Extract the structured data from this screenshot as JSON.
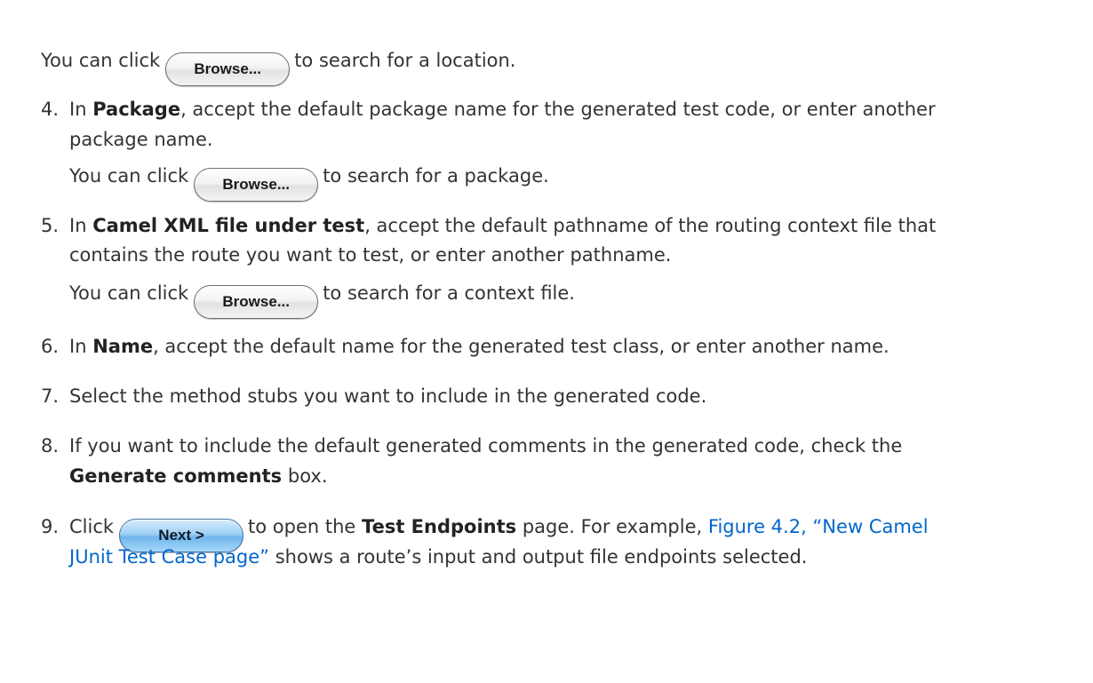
{
  "browse_label": "Browse...",
  "next_label": "Next >",
  "intro": {
    "before": "You can click",
    "after": "to search for a location."
  },
  "steps": [
    {
      "number": "4.",
      "pre": "In",
      "bold": "Package",
      "text": ", accept the default package name for the generated test code, or enter another",
      "text2": "package name.",
      "click_before": "You can click",
      "click_after": "to search for a package."
    },
    {
      "number": "5.",
      "pre": "In",
      "bold": "Camel XML file under test",
      "text": ", accept the default pathname of the routing context file that",
      "text2": "contains the route you want to test, or enter another pathname.",
      "click_before": "You can click",
      "click_after": "to search for a context file."
    },
    {
      "number": "6.",
      "pre": "In",
      "bold": "Name",
      "text": ", accept the default name for the generated test class, or enter another name."
    },
    {
      "number": "7.",
      "text": "Select the method stubs you want to include in the generated code."
    },
    {
      "number": "8.",
      "text": "If you want to include the default generated comments in the generated code, check the",
      "bold2": "Generate comments",
      "text2": "box."
    },
    {
      "number": "9.",
      "pre": "Click",
      "post": "to open the",
      "bold": "Test Endpoints",
      "text": "page. For example,",
      "link": "Figure 4.2, “New Camel",
      "link2": "JUnit Test Case page”",
      "text2": "shows a route’s input and output file endpoints selected."
    }
  ]
}
